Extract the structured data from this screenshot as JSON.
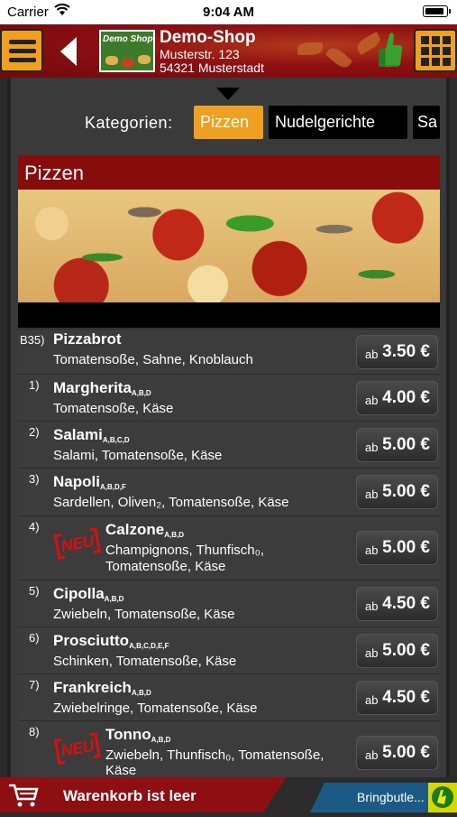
{
  "status_bar": {
    "carrier": "Carrier",
    "time": "9:04 AM"
  },
  "header": {
    "shop_name": "Demo-Shop",
    "address_line1": "Musterstr. 123",
    "address_line2": "54321 Musterstadt",
    "logo_text": "Demo Shop"
  },
  "categories": {
    "label": "Kategorien:",
    "items": [
      "Pizzen",
      "Nudelgerichte",
      "Sa"
    ],
    "active": "Pizzen"
  },
  "section": {
    "title": "Pizzen"
  },
  "menu_items": [
    {
      "number": "B35)",
      "name": "Pizzabrot",
      "allergens": "",
      "description": "Tomatensoße, Sahne, Knoblauch",
      "price_prefix": "ab",
      "price": "3.50 €",
      "is_new": false
    },
    {
      "number": "1)",
      "name": "Margherita",
      "allergens": "A,B,D",
      "description": "Tomatensoße, Käse",
      "price_prefix": "ab",
      "price": "4.00 €",
      "is_new": false
    },
    {
      "number": "2)",
      "name": "Salami",
      "allergens": "A,B,C,D",
      "description": "Salami, Tomatensoße, Käse",
      "price_prefix": "ab",
      "price": "5.00 €",
      "is_new": false
    },
    {
      "number": "3)",
      "name": "Napoli",
      "allergens": "A,B,D,F",
      "description": "Sardellen, Oliven₂, Tomatensoße, Käse",
      "price_prefix": "ab",
      "price": "5.00 €",
      "is_new": false
    },
    {
      "number": "4)",
      "name": "Calzone",
      "allergens": "A,B,D",
      "description": "Champignons, Thunfisch₀,",
      "description2": "Tomatensoße, Käse",
      "price_prefix": "ab",
      "price": "5.00 €",
      "is_new": true,
      "new_label": "NEU"
    },
    {
      "number": "5)",
      "name": "Cipolla",
      "allergens": "A,B,D",
      "description": "Zwiebeln, Tomatensoße, Käse",
      "price_prefix": "ab",
      "price": "4.50 €",
      "is_new": false
    },
    {
      "number": "6)",
      "name": "Prosciutto",
      "allergens": "A,B,C,D,E,F",
      "description": "Schinken, Tomatensoße, Käse",
      "price_prefix": "ab",
      "price": "5.00 €",
      "is_new": false
    },
    {
      "number": "7)",
      "name": "Frankreich",
      "allergens": "A,B,D",
      "description": "Zwiebelringe, Tomatensoße, Käse",
      "price_prefix": "ab",
      "price": "4.50 €",
      "is_new": false
    },
    {
      "number": "8)",
      "name": "Tonno",
      "allergens": "A,B,D",
      "description": "Zwiebeln, Thunfisch₀, Tomatensoße,",
      "description2": "Käse",
      "price_prefix": "ab",
      "price": "5.00 €",
      "is_new": true,
      "new_label": "NEU"
    }
  ],
  "footer": {
    "cart_text": "Warenkorb ist leer",
    "brand_text": "Bringbutle..."
  },
  "colors": {
    "accent": "#f0a020",
    "header_red": "#8e0f12",
    "background": "#2b2b2b"
  }
}
